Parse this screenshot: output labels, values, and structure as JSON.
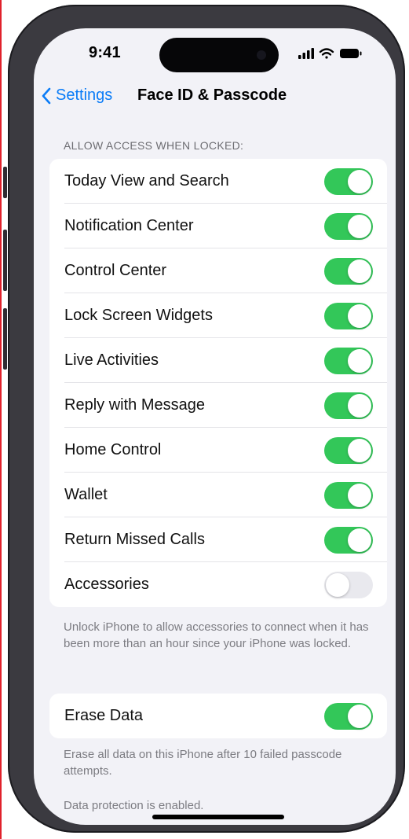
{
  "status": {
    "time": "9:41"
  },
  "nav": {
    "back_label": "Settings",
    "title": "Face ID & Passcode"
  },
  "section_header": "ALLOW ACCESS WHEN LOCKED:",
  "access_items": [
    {
      "label": "Today View and Search",
      "on": true
    },
    {
      "label": "Notification Center",
      "on": true
    },
    {
      "label": "Control Center",
      "on": true
    },
    {
      "label": "Lock Screen Widgets",
      "on": true
    },
    {
      "label": "Live Activities",
      "on": true
    },
    {
      "label": "Reply with Message",
      "on": true
    },
    {
      "label": "Home Control",
      "on": true
    },
    {
      "label": "Wallet",
      "on": true
    },
    {
      "label": "Return Missed Calls",
      "on": true
    },
    {
      "label": "Accessories",
      "on": false
    }
  ],
  "accessories_footnote": "Unlock iPhone to allow accessories to connect when it has been more than an hour since your iPhone was locked.",
  "erase": {
    "label": "Erase Data",
    "on": true
  },
  "erase_footnote": "Erase all data on this iPhone after 10 failed passcode attempts.",
  "protection_note": "Data protection is enabled.",
  "colors": {
    "accent": "#0a7cf7",
    "toggle_on": "#33c759",
    "toggle_off": "#e9e9ee",
    "background": "#f2f2f7"
  }
}
